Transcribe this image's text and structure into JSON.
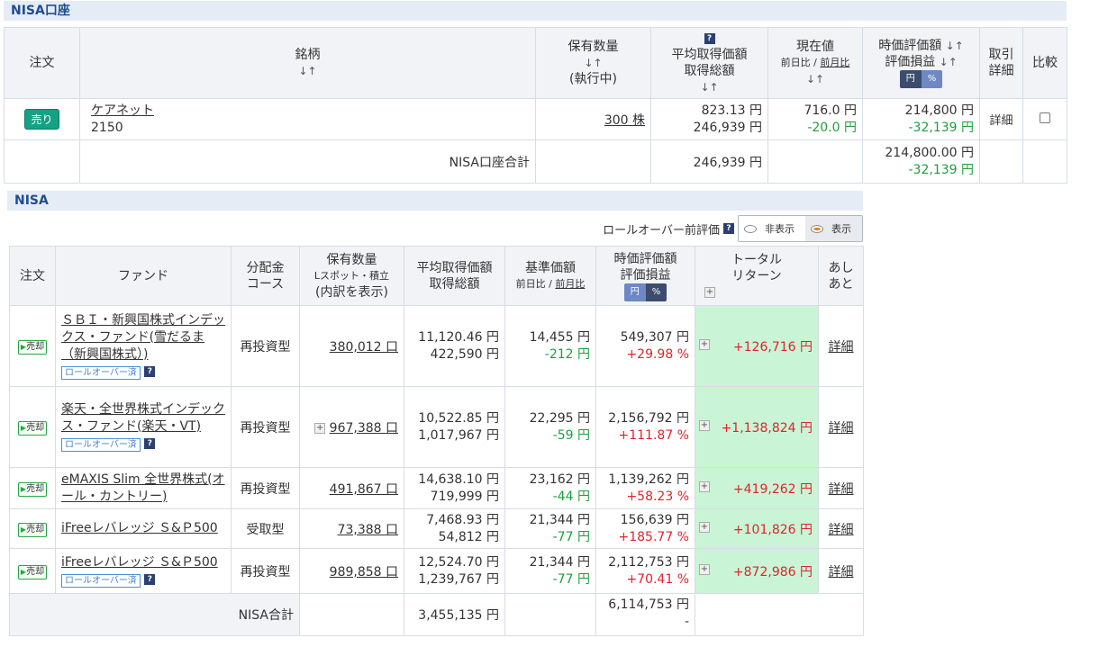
{
  "nisa_account": {
    "section_title": "NISA口座",
    "headers": {
      "order": "注文",
      "name": "銘柄",
      "qty_line1": "保有数量",
      "qty_line2": "(執行中)",
      "avg_line1": "平均取得価額",
      "avg_line2": "取得総額",
      "price_line1": "現在値",
      "price_prev_day": "前日比",
      "price_prev_month": "前月比",
      "val_line1": "時価評価額",
      "val_line2": "評価損益",
      "toggle_yen": "円",
      "toggle_pct": "%",
      "trade_detail_1": "取引",
      "trade_detail_2": "詳細",
      "compare": "比較"
    },
    "row": {
      "sell_label": "売り",
      "name": "ケアネット",
      "code": "2150",
      "qty": "300 株",
      "avg_price": "823.13 円",
      "total_cost": "246,939 円",
      "price": "716.0 円",
      "change": "-20.0 円",
      "value": "214,800 円",
      "pnl": "-32,139 円",
      "detail": "詳細"
    },
    "total": {
      "label": "NISA口座合計",
      "cost": "246,939 円",
      "value": "214,800.00 円",
      "pnl": "-32,139 円"
    }
  },
  "nisa": {
    "section_title": "NISA",
    "rollover_label": "ロールオーバー前評価",
    "radio_hide": "非表示",
    "radio_show": "表示",
    "headers": {
      "order": "注文",
      "fund": "ファンド",
      "dist_1": "分配金",
      "dist_2": "コース",
      "qty_1": "保有数量",
      "qty_2": "Lスポット・積立",
      "qty_3": "(内訳を表示)",
      "avg_1": "平均取得価額",
      "avg_2": "取得総額",
      "base_1": "基準価額",
      "base_prev_day": "前日比",
      "base_prev_month": "前月比",
      "val_1": "時価評価額",
      "val_2": "評価損益",
      "toggle_yen": "円",
      "toggle_pct": "%",
      "total_return_1": "トータル",
      "total_return_2": "リターン",
      "ashi_1": "あし",
      "ashi_2": "あと"
    },
    "sell_label": "売却",
    "rollover_badge": "ロールオーバー済",
    "rows": [
      {
        "name": "ＳＢＩ・新興国株式インデックス・ファンド(雪だるま（新興国株式）)",
        "rollover": true,
        "course": "再投資型",
        "qty": "380,012 口",
        "qty_plus": false,
        "avg": "11,120.46 円",
        "cost": "422,590 円",
        "base": "14,455 円",
        "change": "-212 円",
        "value": "549,307 円",
        "pnl": "+29.98 %",
        "total_return": "+126,716 円",
        "detail": "詳細"
      },
      {
        "name": "楽天・全世界株式インデックス・ファンド(楽天・VT)",
        "rollover": true,
        "course": "再投資型",
        "qty": "967,388 口",
        "qty_plus": true,
        "avg": "10,522.85 円",
        "cost": "1,017,967 円",
        "base": "22,295 円",
        "change": "-59 円",
        "value": "2,156,792 円",
        "pnl": "+111.87 %",
        "total_return": "+1,138,824 円",
        "detail": "詳細"
      },
      {
        "name": "eMAXIS Slim 全世界株式(オール・カントリー)",
        "rollover": false,
        "course": "再投資型",
        "qty": "491,867 口",
        "qty_plus": false,
        "avg": "14,638.10 円",
        "cost": "719,999 円",
        "base": "23,162 円",
        "change": "-44 円",
        "value": "1,139,262 円",
        "pnl": "+58.23 %",
        "total_return": "+419,262 円",
        "detail": "詳細"
      },
      {
        "name": "iFreeレバレッジ Ｓ&Ｐ500",
        "rollover": false,
        "course": "受取型",
        "qty": "73,388 口",
        "qty_plus": false,
        "avg": "7,468.93 円",
        "cost": "54,812 円",
        "base": "21,344 円",
        "change": "-77 円",
        "value": "156,639 円",
        "pnl": "+185.77 %",
        "total_return": "+101,826 円",
        "detail": "詳細"
      },
      {
        "name": "iFreeレバレッジ Ｓ&Ｐ500",
        "rollover": true,
        "course": "再投資型",
        "qty": "989,858 口",
        "qty_plus": false,
        "avg": "12,524.70 円",
        "cost": "1,239,767 円",
        "base": "21,344 円",
        "change": "-77 円",
        "value": "2,112,753 円",
        "pnl": "+70.41 %",
        "total_return": "+872,986 円",
        "detail": "詳細"
      }
    ],
    "total": {
      "label": "NISA合計",
      "cost": "3,455,135 円",
      "value": "6,114,753 円",
      "pnl": "-"
    }
  }
}
